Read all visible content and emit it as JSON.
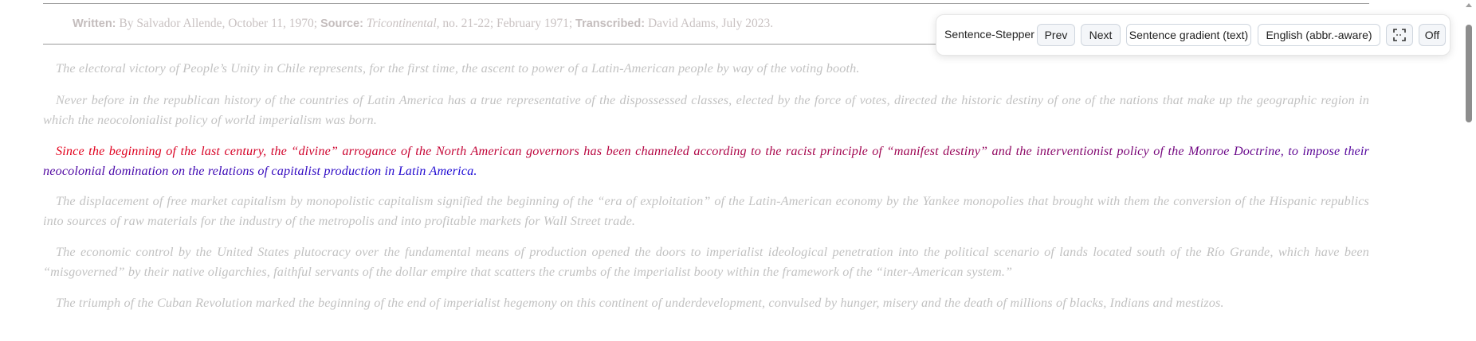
{
  "info": {
    "written_label": "Written:",
    "written_value": "By Salvador Allende, October 11, 1970;",
    "source_label": "Source:",
    "source_title": "Tricontinental",
    "source_value": ", no. 21-22; February 1971;",
    "transcribed_label": "Transcribed:",
    "transcribed_value": "David Adams, July 2023."
  },
  "paragraphs": [
    "The electoral victory of People’s Unity in Chile represents, for the first time, the ascent to power of a Latin-American people by way of the voting booth.",
    "Never before in the republican history of the countries of Latin America has a true representative of the dispossessed classes, elected by the force of votes, directed the historic destiny of one of the nations that make up the geographic region in which the neocolonialist policy of world imperialism was born.",
    "Since the beginning of the last century, the “divine” arrogance of the North American governors has been channeled according to the racist principle of “manifest destiny” and the interventionist policy of the Monroe Doctrine, to impose their neocolonial domination on the relations of capitalist production in Latin America.",
    "The displacement of free market capitalism by monopolistic capitalism signified the beginning of the “era of exploitation” of the Latin-American economy by the Yankee monopolies that brought with them the conversion of the Hispanic republics into sources of raw materials for the industry of the metropolis and into profitable markets for Wall Street trade.",
    "The economic control by the United States plutocracy over the fundamental means of production opened the doors to imperialist ideological penetration into the political scenario of lands located south of the Río Grande, which have been “misgoverned” by their native oligarchies, faithful servants of the dollar empire that scatters the crumbs of the imperialist booty within the framework of the “inter-American system.”",
    "The triumph of the Cuban Revolution marked the beginning of the end of imperialist hegemony on this continent of underdevelopment, convulsed by hunger, misery and the death of millions of blacks, Indians and mestizos."
  ],
  "toolbar": {
    "title": "Sentence-Stepper",
    "prev_label": "Prev",
    "next_label": "Next",
    "gradient_label": "Sentence gradient (text)",
    "language_label": "English (abbr.-aware)",
    "fullscreen_icon": "fullscreen-icon",
    "off_label": "Off"
  },
  "colors": {
    "dim_text": "#c2c2c2",
    "gradient_start": "#e4001a",
    "gradient_end": "#1c0cd8"
  }
}
